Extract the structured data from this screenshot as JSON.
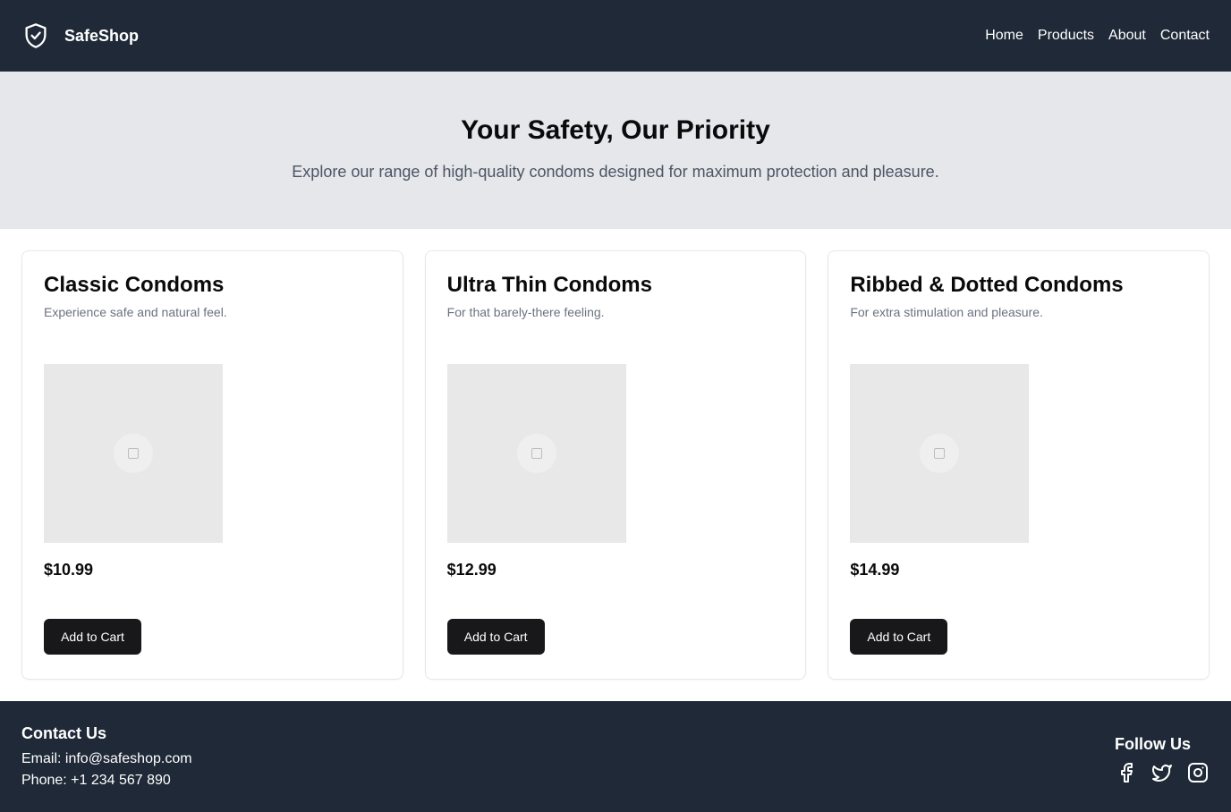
{
  "nav": {
    "brand": "SafeShop",
    "brand_icon": "shield-check-icon",
    "links": [
      {
        "label": "Home"
      },
      {
        "label": "Products"
      },
      {
        "label": "About"
      },
      {
        "label": "Contact"
      }
    ]
  },
  "hero": {
    "title": "Your Safety, Our Priority",
    "subtitle": "Explore our range of high-quality condoms designed for maximum protection and pleasure."
  },
  "products": [
    {
      "title": "Classic Condoms",
      "description": "Experience safe and natural feel.",
      "price": "$10.99",
      "button": "Add to Cart"
    },
    {
      "title": "Ultra Thin Condoms",
      "description": "For that barely-there feeling.",
      "price": "$12.99",
      "button": "Add to Cart"
    },
    {
      "title": "Ribbed & Dotted Condoms",
      "description": "For extra stimulation and pleasure.",
      "price": "$14.99",
      "button": "Add to Cart"
    }
  ],
  "footer": {
    "contact_title": "Contact Us",
    "email": "Email: info@safeshop.com",
    "phone": "Phone: +1 234 567 890",
    "follow_title": "Follow Us",
    "social_icons": [
      "facebook-icon",
      "twitter-icon",
      "instagram-icon"
    ]
  },
  "colors": {
    "nav_bg": "#1f2937",
    "hero_bg": "#e5e7eb",
    "button_bg": "#18181b",
    "footer_bg": "#1f2937"
  }
}
